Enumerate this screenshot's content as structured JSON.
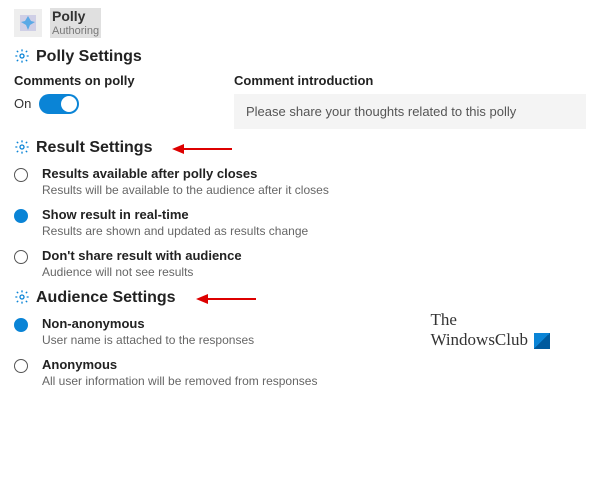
{
  "header": {
    "title": "Polly",
    "subtitle": "Authoring"
  },
  "polly_section": {
    "title": "Polly Settings",
    "comments_label": "Comments on polly",
    "comments_state": "On",
    "intro_label": "Comment introduction",
    "intro_text": "Please share your thoughts related to this polly"
  },
  "result_section": {
    "title": "Result Settings",
    "options": [
      {
        "title": "Results available after polly closes",
        "desc": "Results will be available to the audience after it closes",
        "selected": false
      },
      {
        "title": "Show result in real-time",
        "desc": "Results are shown and updated as results change",
        "selected": true
      },
      {
        "title": "Don't share result with audience",
        "desc": "Audience will not see results",
        "selected": false
      }
    ]
  },
  "audience_section": {
    "title": "Audience Settings",
    "options": [
      {
        "title": "Non-anonymous",
        "desc": "User name is attached to the responses",
        "selected": true
      },
      {
        "title": "Anonymous",
        "desc": "All user information will be removed from responses",
        "selected": false
      }
    ]
  },
  "watermark": {
    "line1": "The",
    "line2": "WindowsClub"
  }
}
